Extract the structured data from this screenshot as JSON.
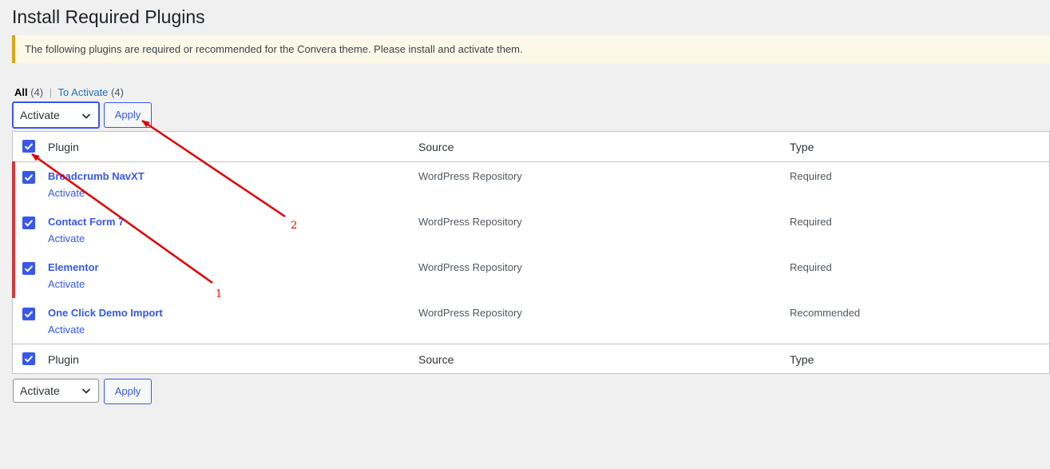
{
  "page": {
    "title": "Install Required Plugins"
  },
  "notice": {
    "text": "The following plugins are required or recommended for the Convera theme. Please install and activate them."
  },
  "views": {
    "all_label": "All",
    "all_count": "(4)",
    "to_activate_label": "To Activate",
    "to_activate_count": "(4)"
  },
  "bulk_actions": {
    "selected": "Activate",
    "apply_label": "Apply"
  },
  "table": {
    "columns": {
      "plugin": "Plugin",
      "source": "Source",
      "type": "Type"
    },
    "rows": [
      {
        "name": "Breadcrumb NavXT",
        "action": "Activate",
        "source": "WordPress Repository",
        "type": "Required"
      },
      {
        "name": "Contact Form 7",
        "action": "Activate",
        "source": "WordPress Repository",
        "type": "Required"
      },
      {
        "name": "Elementor",
        "action": "Activate",
        "source": "WordPress Repository",
        "type": "Required"
      },
      {
        "name": "One Click Demo Import",
        "action": "Activate",
        "source": "WordPress Repository",
        "type": "Recommended"
      }
    ]
  },
  "annotations": {
    "label_1": "1",
    "label_2": "2",
    "arrow_color": "#e00000"
  },
  "icons": {
    "checkbox": "checkmark-icon",
    "select": "chevron-down-icon"
  },
  "colors": {
    "accent": "#3858e9",
    "required_bar": "#d63638",
    "notice_border": "#dba617"
  }
}
